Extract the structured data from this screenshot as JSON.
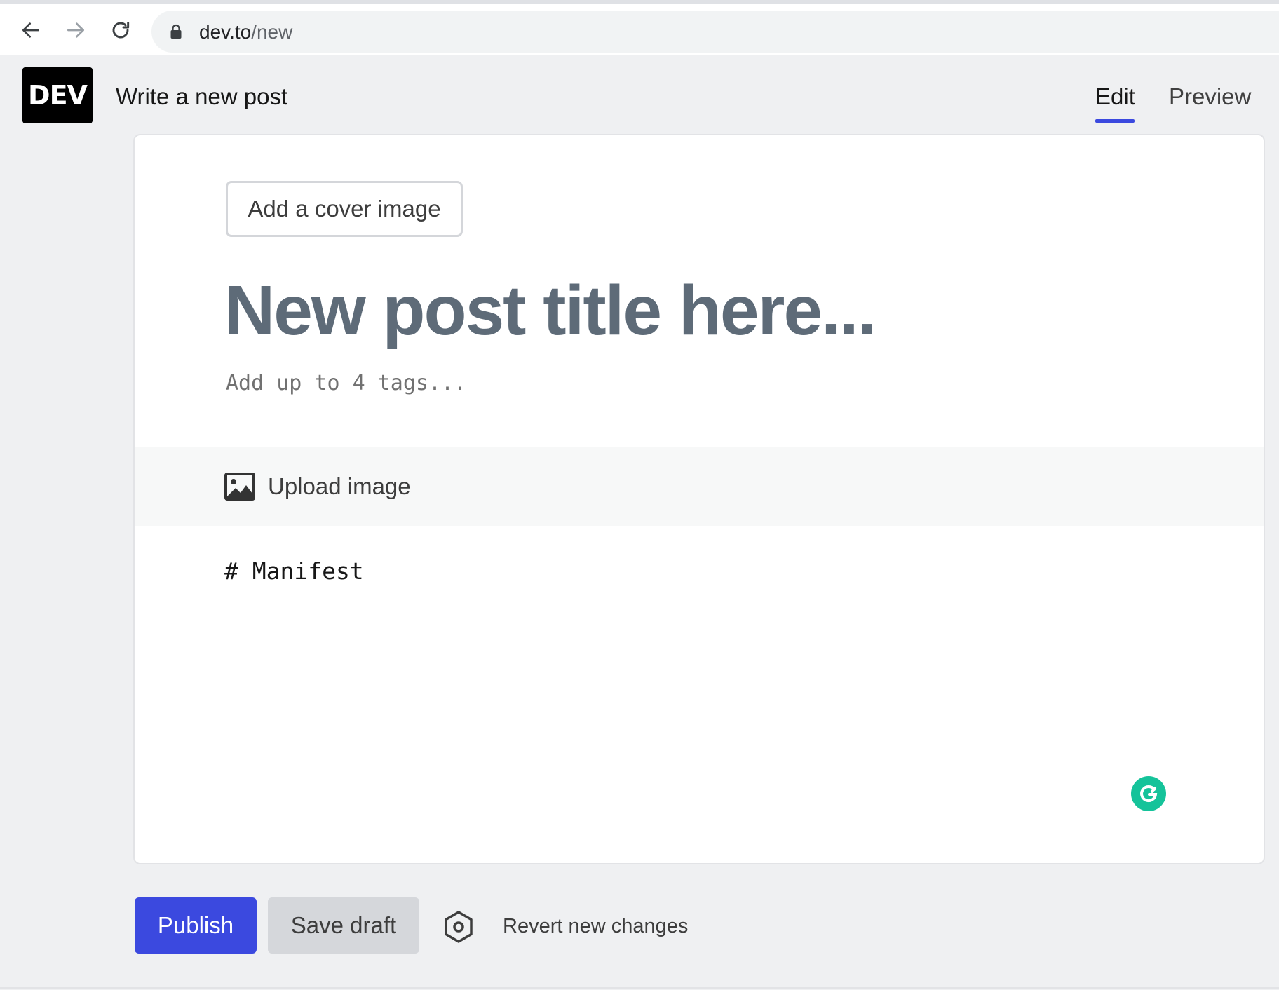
{
  "browser": {
    "url_host": "dev.to",
    "url_path": "/new",
    "back_icon": "back-arrow-icon",
    "forward_icon": "forward-arrow-icon",
    "reload_icon": "reload-icon",
    "secure_icon": "lock-icon"
  },
  "header": {
    "logo_text": "DEV",
    "title": "Write a new post",
    "tabs": [
      {
        "label": "Edit",
        "active": true
      },
      {
        "label": "Preview",
        "active": false
      }
    ]
  },
  "editor": {
    "cover_button_label": "Add a cover image",
    "title_placeholder": "New post title here...",
    "title_value": "",
    "tags_placeholder": "Add up to 4 tags...",
    "upload_image_label": "Upload image",
    "upload_icon": "image-icon",
    "body_value": "# Manifest",
    "grammarly_icon": "grammarly-icon"
  },
  "actions": {
    "publish_label": "Publish",
    "save_draft_label": "Save draft",
    "settings_icon": "hexagon-settings-icon",
    "revert_label": "Revert new changes"
  },
  "colors": {
    "accent": "#3b49df",
    "logo_bg": "#000000",
    "grammarly": "#15c39a",
    "page_bg": "#eff0f2",
    "title_placeholder": "#5e6b78"
  }
}
